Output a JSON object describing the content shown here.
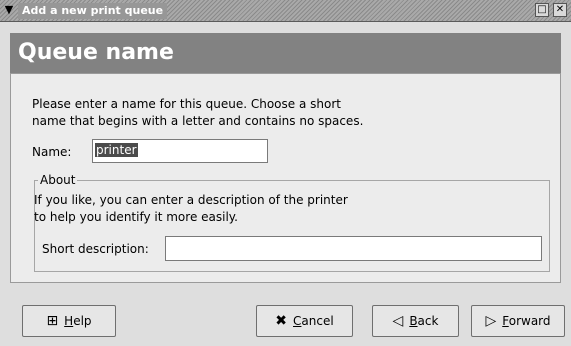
{
  "window": {
    "title": "Add a new print queue",
    "menu_icon": "chevron-down-icon",
    "maximize_icon": "maximize-icon",
    "close_icon": "close-icon"
  },
  "header": {
    "title": "Queue name"
  },
  "intro": {
    "line1": "Please enter a name for this queue.  Choose a short",
    "line2": "name that begins with a letter and contains no spaces."
  },
  "name_field": {
    "label": "Name:",
    "value": "printer"
  },
  "about": {
    "frame_label": "About",
    "line1": "If you like, you can enter a description of the printer",
    "line2": "to help you identify it more easily.",
    "desc_label": "Short description:",
    "desc_value": ""
  },
  "buttons": {
    "help": {
      "mnemonic": "H",
      "rest": "elp"
    },
    "cancel": {
      "mnemonic": "C",
      "rest": "ancel"
    },
    "back": {
      "mnemonic": "B",
      "rest": "ack"
    },
    "forward": {
      "mnemonic": "F",
      "rest": "orward"
    }
  }
}
